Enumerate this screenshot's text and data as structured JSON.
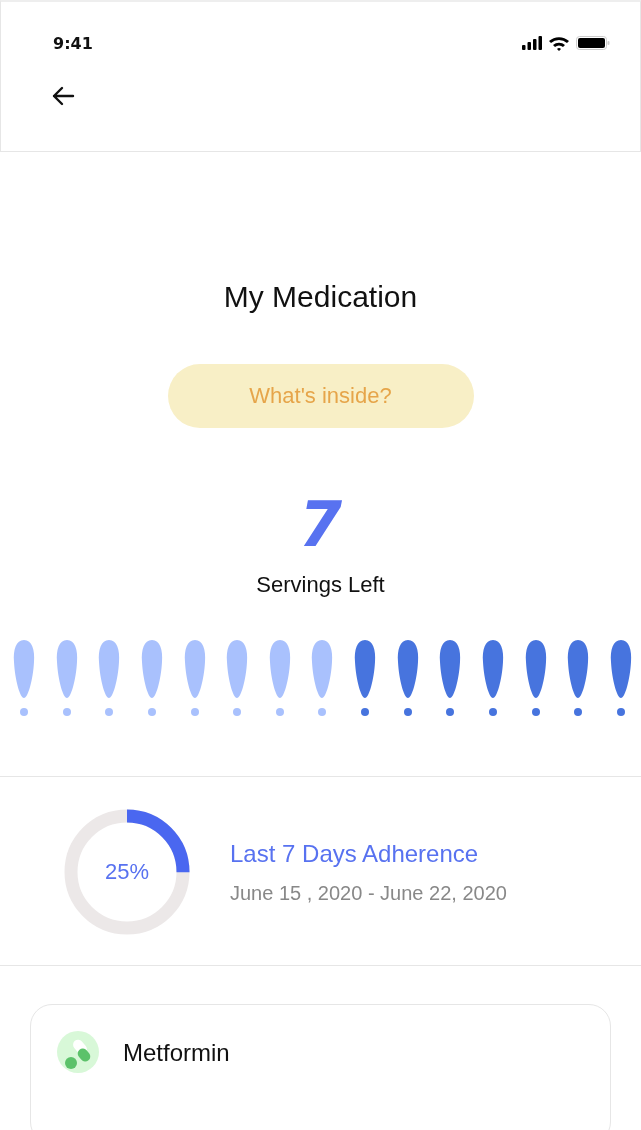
{
  "status_bar": {
    "time": "9:41"
  },
  "title": "My Medication",
  "inside_button": {
    "label": "What's inside?"
  },
  "servings": {
    "count": "7",
    "label": "Servings Left",
    "drops": [
      {
        "remaining": false
      },
      {
        "remaining": false
      },
      {
        "remaining": false
      },
      {
        "remaining": false
      },
      {
        "remaining": false
      },
      {
        "remaining": false
      },
      {
        "remaining": false
      },
      {
        "remaining": false
      },
      {
        "remaining": true
      },
      {
        "remaining": true
      },
      {
        "remaining": true
      },
      {
        "remaining": true
      },
      {
        "remaining": true
      },
      {
        "remaining": true
      },
      {
        "remaining": true
      }
    ]
  },
  "adherence": {
    "level": 0.25,
    "reading": "25%",
    "title": "Last 7 Days Adherence",
    "dates": "June 15 , 2020 - June 22, 2020"
  },
  "medications": [
    {
      "name": "Metformin"
    }
  ]
}
